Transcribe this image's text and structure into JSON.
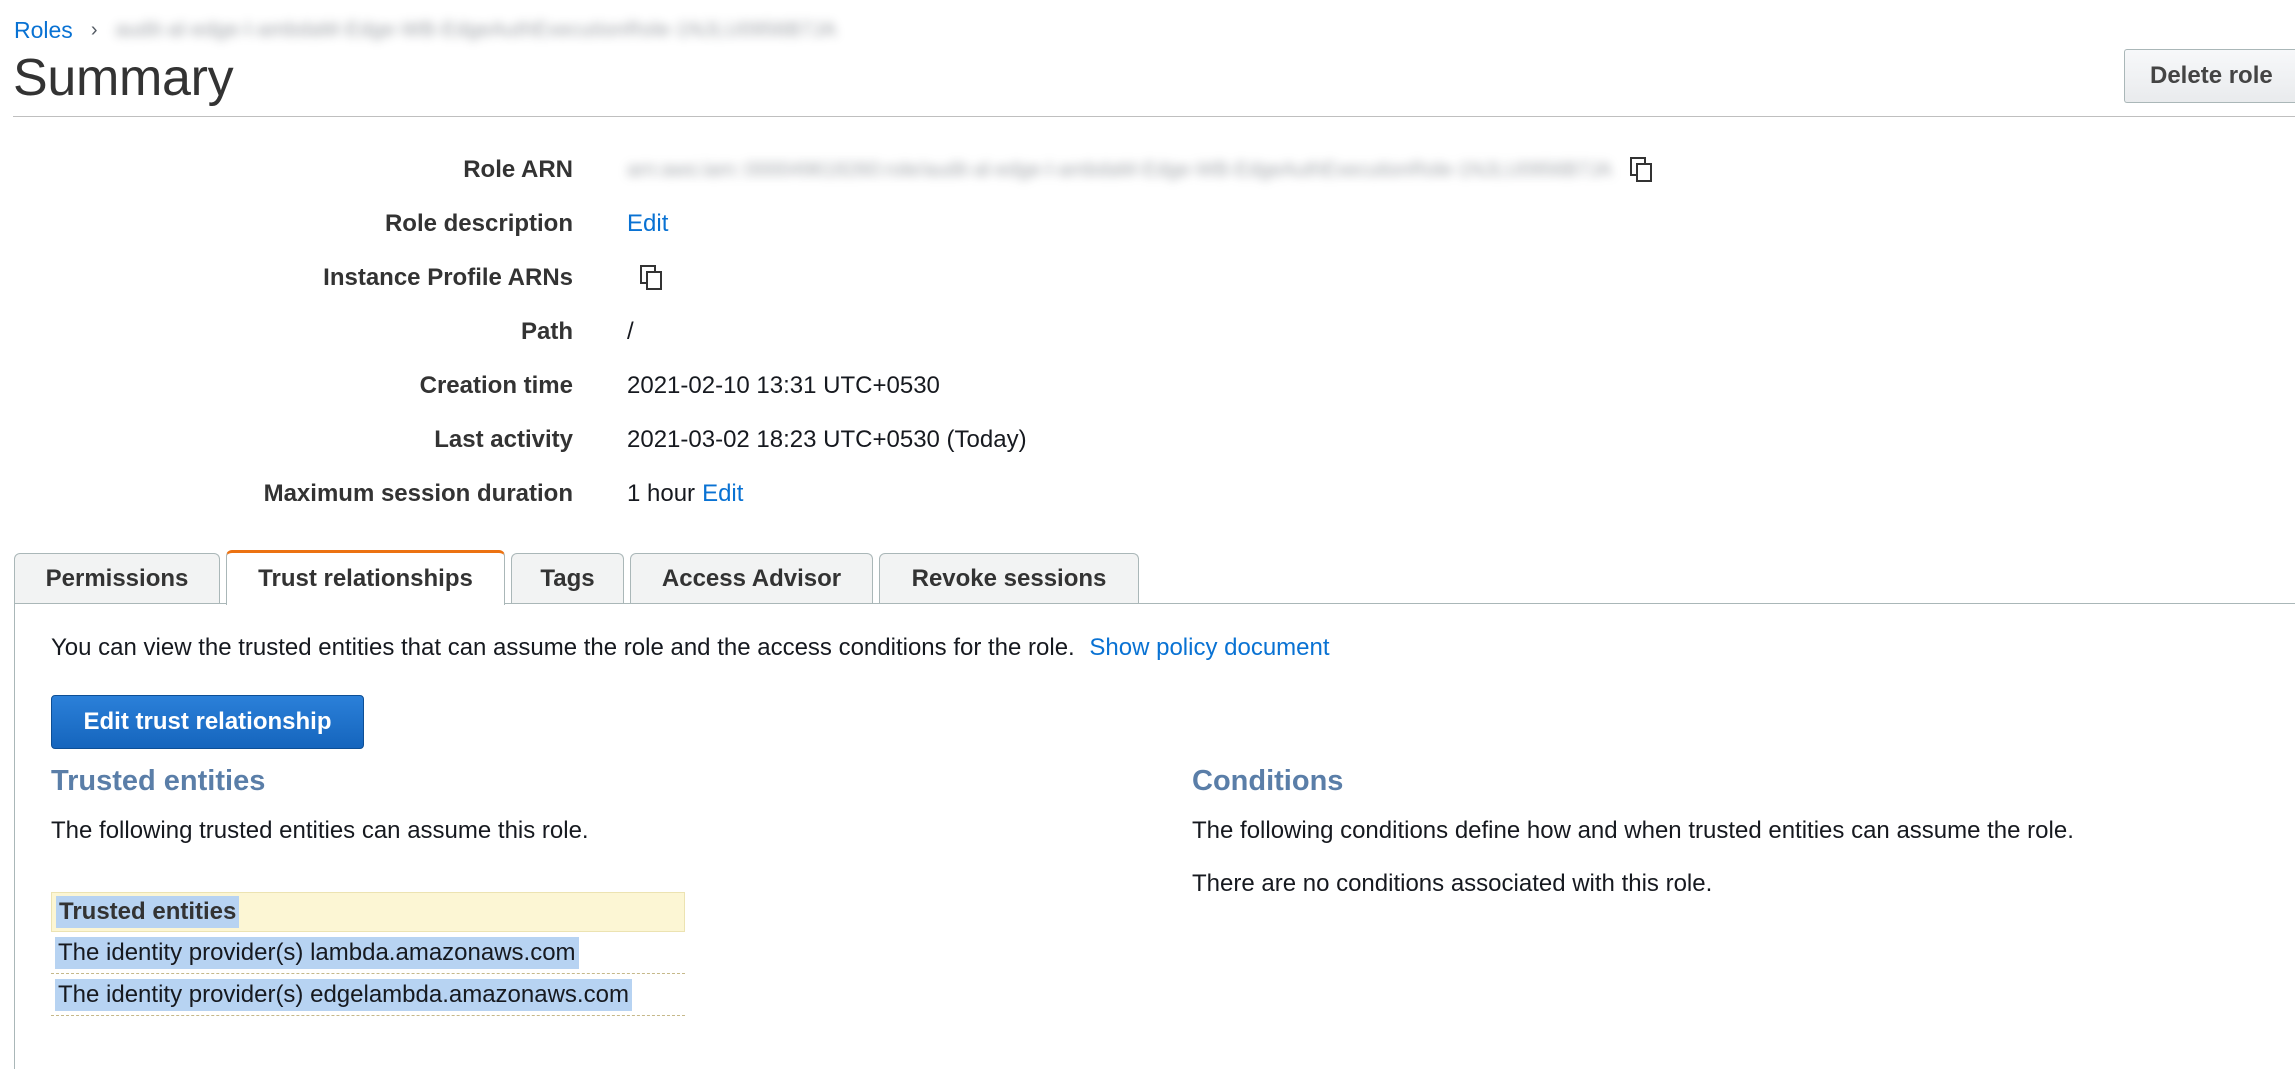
{
  "breadcrumb": {
    "root_label": "Roles",
    "separator": "›",
    "current_label": "audit-al-edge-l-ambdaM-Edge-WB-EdgeAuthExecutionRole-1NJLU0956B7JA"
  },
  "header": {
    "title": "Summary",
    "delete_button": "Delete role"
  },
  "summary": {
    "role_arn_label": "Role ARN",
    "role_arn_value": "arn:aws:iam::000049618260:role/audit-al-edge-l-ambdaM-Edge-WB-EdgeAuthExecutionRole-1NJLU0956B7JA",
    "role_description_label": "Role description",
    "role_description_edit": "Edit",
    "instance_profile_label": "Instance Profile ARNs",
    "path_label": "Path",
    "path_value": "/",
    "creation_time_label": "Creation time",
    "creation_time_value": "2021-02-10 13:31 UTC+0530",
    "last_activity_label": "Last activity",
    "last_activity_value": "2021-03-02 18:23 UTC+0530 (Today)",
    "max_session_label": "Maximum session duration",
    "max_session_value": "1 hour",
    "max_session_edit": "Edit"
  },
  "tabs": [
    {
      "label": "Permissions",
      "active": false
    },
    {
      "label": "Trust relationships",
      "active": true
    },
    {
      "label": "Tags",
      "active": false
    },
    {
      "label": "Access Advisor",
      "active": false
    },
    {
      "label": "Revoke sessions",
      "active": false
    }
  ],
  "trust_panel": {
    "intro_text": "You can view the trusted entities that can assume the role and the access conditions for the role.",
    "show_policy_link": "Show policy document",
    "edit_button": "Edit trust relationship",
    "trusted_entities_heading": "Trusted entities",
    "trusted_entities_text": "The following trusted entities can assume this role.",
    "table_header": "Trusted entities",
    "entities": [
      "The identity provider(s) lambda.amazonaws.com",
      "The identity provider(s) edgelambda.amazonaws.com"
    ],
    "conditions_heading": "Conditions",
    "conditions_text": "The following conditions define how and when trusted entities can assume the role.",
    "no_conditions_text": "There are no conditions associated with this role."
  },
  "icons": {
    "copy": "copy-icon",
    "breadcrumb_separator": "chevron-right-icon"
  },
  "colors": {
    "link": "#0972d3",
    "active_tab_accent": "#ec7211",
    "primary_button": "#1f6fc5",
    "section_heading": "#5a7ea8",
    "table_header_bg": "#fcf6d4",
    "selection_highlight": "#b7d3f2"
  }
}
